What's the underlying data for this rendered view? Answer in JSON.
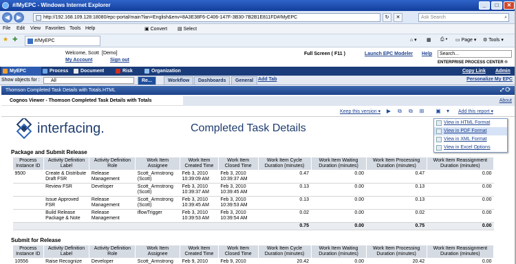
{
  "window": {
    "title": "#/MyEPC - Windows Internet Explorer"
  },
  "address": {
    "url": "http://192.168.109.128:18080/epc-portal/main?lan=English&env=8A3E38F6-C406-147F-3B30-7B2B1E811FD#/MyEPC",
    "search_placeholder": "Ask Search"
  },
  "menubar": [
    "File",
    "Edit",
    "View",
    "Favorites",
    "Tools",
    "Help"
  ],
  "toolbar": {
    "convert": "Convert",
    "select": "Select",
    "fav_tab": "#/MyEPC",
    "page": "Page",
    "tools": "Tools"
  },
  "portal": {
    "welcome": "Welcome, Scott",
    "demo": "[Demo]",
    "my_account": "My Account",
    "sign_out": "Sign out",
    "full_screen": "Full Screen ( F11 )",
    "launch_modeler": "Launch EPC Modeler",
    "help": "Help",
    "search_label": "Search...",
    "brand": "ENTERPRISE PROCESS CENTER ®",
    "copy_link": "Copy Link",
    "admin": "Admin"
  },
  "main_tabs": [
    {
      "label": "MyEPC",
      "color": "#f0a030"
    },
    {
      "label": "Process",
      "color": "#6aa6e8"
    },
    {
      "label": "Document",
      "color": "#e8e8e8"
    },
    {
      "label": "Risk",
      "color": "#d03020"
    },
    {
      "label": "Organization",
      "color": "#8ec0f0"
    }
  ],
  "subtabs": {
    "show_objects": "Show objects for :",
    "all": "All",
    "tabs": [
      "Re...",
      "Workflow",
      "Dashboards",
      "General"
    ],
    "add_tab": "Add Tab",
    "personalize": "Personalize My EPC"
  },
  "frame_title": "Thomson Completed Task Details with Totals.HTML",
  "cognos": {
    "title": "Cognos Viewer - Thomson Completed Task Details with Totals",
    "about": "About",
    "keep_version": "Keep this version",
    "add_report": "Add this report"
  },
  "report": {
    "logo_text": "interfacing.",
    "title": "Completed Task Details"
  },
  "format_menu": [
    "View in HTML Format",
    "View in PDF Format",
    "View in XML Format",
    "View in Excel Options"
  ],
  "section1": {
    "title": "Package and Submit Release",
    "headers": [
      "Process Instance ID",
      "Activity Definition Label",
      "Activity Definition Role",
      "Work Item Assignee",
      "Work Item Created Time",
      "Work Item Closed Time",
      "Work Item Cycle Duration (minutes)",
      "Work Item Waiting Duration (minutes)",
      "Work Item Processing Duration (minutes)",
      "Work Item Reassignment Duration (minutes)"
    ],
    "rows": [
      [
        "9500",
        "Create & Distribute Draft FSR",
        "Release Management",
        "Scott_Armstrong (Scott)",
        "Feb 3, 2010 10:39:09 AM",
        "Feb 3, 2010 10:39:37 AM",
        "0.47",
        "0.00",
        "0.47",
        "0.00"
      ],
      [
        "",
        "Review FSR",
        "Developer",
        "Scott_Armstrong (Scott)",
        "Feb 3, 2010 10:39:37 AM",
        "Feb 3, 2010 10:39:45 AM",
        "0.13",
        "0.00",
        "0.13",
        "0.00"
      ],
      [
        "",
        "Issue Approved FSR",
        "Release Management",
        "Scott_Armstrong (Scott)",
        "Feb 3, 2010 10:39:45 AM",
        "Feb 3, 2010 10:39:53 AM",
        "0.13",
        "0.00",
        "0.13",
        "0.00"
      ],
      [
        "",
        "Build Release Package & Note",
        "Release Management",
        "iflowTrigger",
        "Feb 3, 2010 10:39:53 AM",
        "Feb 3, 2010 10:39:54 AM",
        "0.02",
        "0.00",
        "0.02",
        "0.00"
      ]
    ],
    "totals": [
      "0.75",
      "0.00",
      "0.75",
      "0.00"
    ]
  },
  "section2": {
    "title": "Submit for Release",
    "headers": [
      "Process Instance ID",
      "Activity Definition Label",
      "Activity Definition Role",
      "Work Item Assignee",
      "Work Item Created Time",
      "Work Item Closed Time",
      "Work Item Cycle Duration (minutes)",
      "Work Item Waiting Duration (minutes)",
      "Work Item Processing Duration (minutes)",
      "Work Item Reassignment Duration (minutes)"
    ],
    "rows": [
      [
        "10556",
        "Raise Recognize",
        "Developer",
        "Scott_Armstrong",
        "Feb 9, 2010",
        "Feb 9, 2010",
        "20.42",
        "0.00",
        "20.42",
        "0.00"
      ]
    ]
  }
}
